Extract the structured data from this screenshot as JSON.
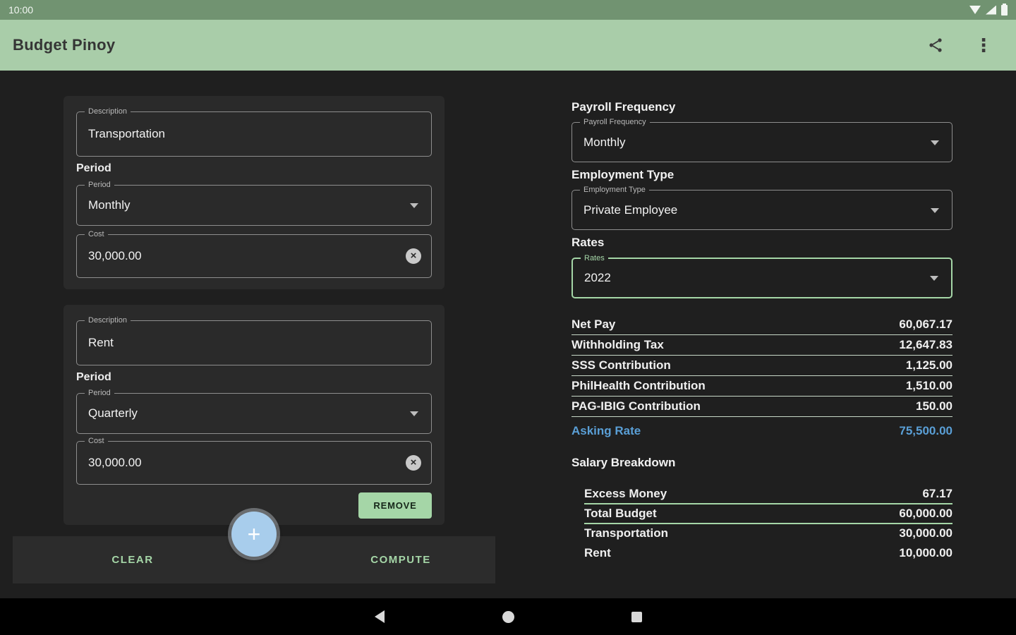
{
  "status_bar": {
    "time": "10:00"
  },
  "app_bar": {
    "title": "Budget Pinoy"
  },
  "icons": {
    "plus": "+",
    "clear": "×",
    "overflow_dots": "⋮"
  },
  "colors": {
    "accent_green": "#a5d6a7",
    "accent_blue": "#5a9fd6",
    "appbar_green": "#a9cda9",
    "statusbar_green": "#719371",
    "fab_blue": "#a8cdec"
  },
  "left": {
    "cards": [
      {
        "description_label": "Description",
        "description_value": "Transportation",
        "period_heading": "Period",
        "period_label": "Period",
        "period_value": "Monthly",
        "cost_label": "Cost",
        "cost_value": "30,000.00"
      },
      {
        "description_label": "Description",
        "description_value": "Rent",
        "period_heading": "Period",
        "period_label": "Period",
        "period_value": "Quarterly",
        "cost_label": "Cost",
        "cost_value": "30,000.00",
        "remove_label": "REMOVE"
      }
    ],
    "actions": {
      "clear": "CLEAR",
      "compute": "COMPUTE"
    }
  },
  "right": {
    "payroll_frequency": {
      "heading": "Payroll Frequency",
      "label": "Payroll Frequency",
      "value": "Monthly"
    },
    "employment_type": {
      "heading": "Employment Type",
      "label": "Employment Type",
      "value": "Private Employee"
    },
    "rates": {
      "heading": "Rates",
      "label": "Rates",
      "value": "2022"
    },
    "results": {
      "rows": [
        {
          "label": "Net Pay",
          "value": "60,067.17"
        },
        {
          "label": "Withholding Tax",
          "value": "12,647.83"
        },
        {
          "label": "SSS Contribution",
          "value": "1,125.00"
        },
        {
          "label": "PhilHealth Contribution",
          "value": "1,510.00"
        },
        {
          "label": "PAG-IBIG Contribution",
          "value": "150.00"
        }
      ],
      "asking_rate": {
        "label": "Asking Rate",
        "value": "75,500.00"
      }
    },
    "salary_breakdown": {
      "heading": "Salary Breakdown",
      "rows": [
        {
          "label": "Excess Money",
          "value": "67.17"
        },
        {
          "label": "Total Budget",
          "value": "60,000.00"
        },
        {
          "label": "Transportation",
          "value": "30,000.00"
        },
        {
          "label": "Rent",
          "value": "10,000.00"
        }
      ]
    }
  }
}
